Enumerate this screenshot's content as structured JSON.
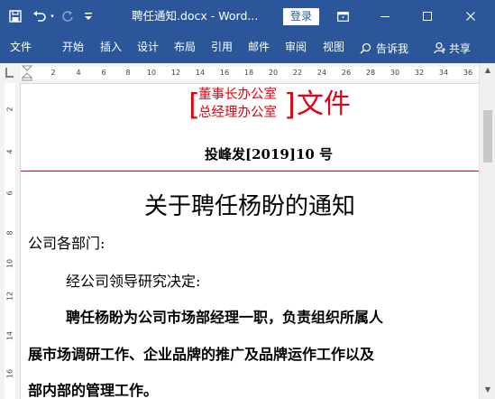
{
  "titlebar": {
    "save_icon": "save-icon",
    "undo_icon": "undo-icon",
    "redo_icon": "redo-icon",
    "customize_icon": "customize-quick-access-icon",
    "doc_title": "聘任通知.docx - Word...",
    "login_label": "登录",
    "ribbon_display_icon": "ribbon-display-options-icon",
    "minimize_icon": "minimize-icon",
    "maximize_icon": "maximize-icon",
    "close_icon": "close-icon",
    "bg_color": "#2b579a"
  },
  "ribbon": {
    "tabs": [
      "文件",
      "开始",
      "插入",
      "设计",
      "布局",
      "引用",
      "邮件",
      "审阅",
      "视图"
    ],
    "tellme_label": "告诉我",
    "share_label": "共享"
  },
  "ruler": {
    "h_ticks": [
      "2",
      "4",
      "6",
      "8",
      "10",
      "12",
      "14",
      "16",
      "18",
      "20",
      "22",
      "24",
      "26",
      "28",
      "30",
      "32",
      "34",
      "36"
    ],
    "v_ticks": [
      "2",
      "4",
      "6",
      "8",
      "10",
      "12",
      "14",
      "16"
    ]
  },
  "document": {
    "header_bracket_line1": "董事长办公室",
    "header_bracket_line2": "总经理办公室",
    "header_suffix": "文件",
    "doc_number": "投峰发[2019]10 号",
    "title": "关于聘任杨盼的通知",
    "salutation": "公司各部门:",
    "para1": "经公司领导研究决定:",
    "para2_line1": "聘任杨盼为公司市场部经理一职，负责组织所属人",
    "para2_line2": "展市场调研工作、企业品牌的推广及品牌运作工作以及",
    "para2_line3": "部内部的管理工作。",
    "accent_color": "#e60012"
  }
}
